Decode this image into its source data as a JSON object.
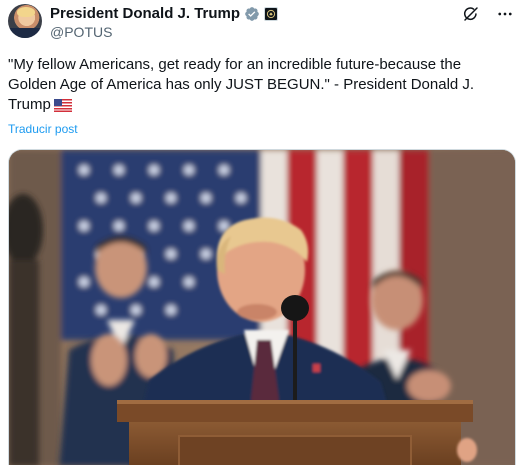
{
  "post": {
    "display_name": "President Donald J. Trump",
    "handle": "@POTUS",
    "text": "\"My fellow Americans, get ready for an incredible future-because the Golden Age of America has only JUST BEGUN.\" - President Donald J. Trump",
    "flag_emoji": "US flag",
    "translate_label": "Traducir post",
    "icons": {
      "verified": "verified-badge-icon",
      "affiliate": "affiliate-badge-icon",
      "grok": "grok-icon",
      "more": "more-icon"
    },
    "colors": {
      "link": "#1d9bf0",
      "secondary_text": "#536471",
      "verified": "#829aab"
    }
  }
}
